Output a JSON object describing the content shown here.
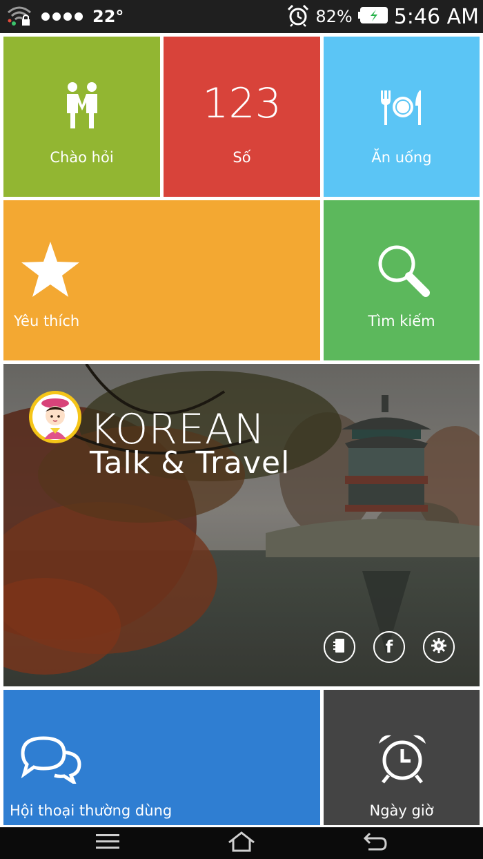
{
  "status_bar": {
    "temperature": "22°",
    "battery_percent": "82%",
    "time": "5:46 AM",
    "icons": [
      "wifi-lock-icon",
      "signal-dots-icon",
      "alarm-clock-icon",
      "battery-charging-icon"
    ]
  },
  "tiles": {
    "greeting": {
      "label": "Chào hỏi",
      "icon": "people-icon",
      "color": "#92b632"
    },
    "numbers": {
      "label": "Số",
      "icon_text": "123",
      "color": "#d8433a"
    },
    "food": {
      "label": "Ăn uống",
      "icon": "dining-icon",
      "color": "#5bc5f5"
    },
    "favorites": {
      "label": "Yêu thích",
      "icon": "star-icon",
      "color": "#f3a832"
    },
    "search": {
      "label": "Tìm kiếm",
      "icon": "search-icon",
      "color": "#5cb85c"
    },
    "conversations": {
      "label": "Hội thoại thường dùng",
      "icon": "chat-bubbles-icon",
      "color": "#2f7ed2"
    },
    "datetime": {
      "label": "Ngày giờ",
      "icon": "alarm-clock-icon",
      "color": "#444444"
    }
  },
  "banner": {
    "title": "KOREAN",
    "subtitle": "Talk & Travel",
    "buttons": [
      "contacts-icon",
      "facebook-icon",
      "settings-icon"
    ]
  },
  "nav_bar": {
    "buttons": [
      "menu-icon",
      "home-icon",
      "back-icon"
    ]
  }
}
